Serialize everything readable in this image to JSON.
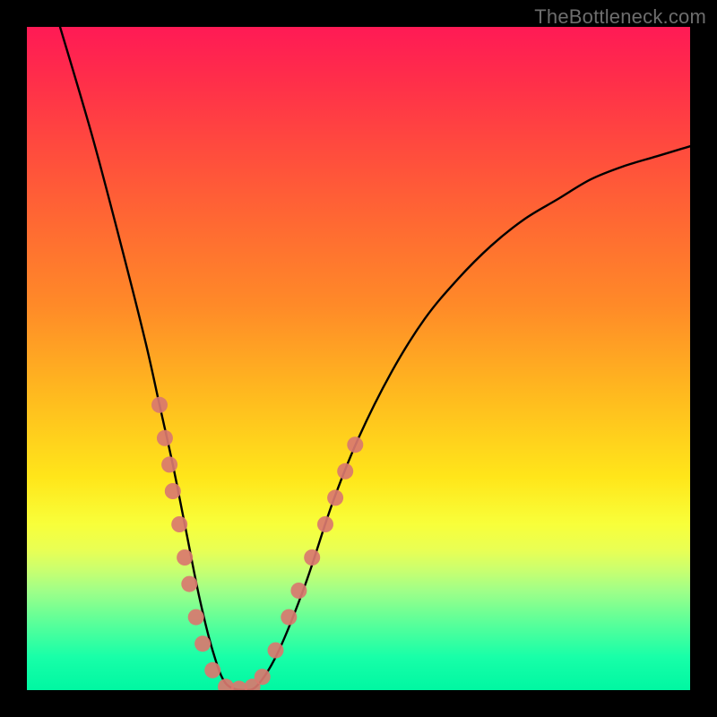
{
  "attribution": "TheBottleneck.com",
  "colors": {
    "black": "#000000",
    "curve_stroke": "#000000",
    "marker_fill": "#d9786f",
    "marker_stroke": "#d9786f",
    "attribution_text": "#6d6d6d"
  },
  "chart_data": {
    "type": "line",
    "title": "",
    "xlabel": "",
    "ylabel": "",
    "xlim": [
      0,
      100
    ],
    "ylim": [
      0,
      100
    ],
    "grid": false,
    "legend": false,
    "annotations": [],
    "series": [
      {
        "name": "curve",
        "x": [
          5,
          10,
          15,
          18,
          20,
          22,
          24,
          26,
          28,
          30,
          33,
          35,
          38,
          42,
          46,
          50,
          55,
          60,
          65,
          70,
          75,
          80,
          85,
          90,
          95,
          100
        ],
        "values": [
          100,
          83,
          64,
          52,
          43,
          34,
          24,
          14,
          6,
          1,
          0,
          1,
          6,
          16,
          28,
          38,
          48,
          56,
          62,
          67,
          71,
          74,
          77,
          79,
          80.5,
          82
        ]
      }
    ],
    "markers": [
      {
        "x": 20.0,
        "y": 43
      },
      {
        "x": 20.8,
        "y": 38
      },
      {
        "x": 21.5,
        "y": 34
      },
      {
        "x": 22.0,
        "y": 30
      },
      {
        "x": 23.0,
        "y": 25
      },
      {
        "x": 23.8,
        "y": 20
      },
      {
        "x": 24.5,
        "y": 16
      },
      {
        "x": 25.5,
        "y": 11
      },
      {
        "x": 26.5,
        "y": 7
      },
      {
        "x": 28.0,
        "y": 3
      },
      {
        "x": 30.0,
        "y": 0.5
      },
      {
        "x": 32.0,
        "y": 0.2
      },
      {
        "x": 34.0,
        "y": 0.5
      },
      {
        "x": 35.5,
        "y": 2
      },
      {
        "x": 37.5,
        "y": 6
      },
      {
        "x": 39.5,
        "y": 11
      },
      {
        "x": 41.0,
        "y": 15
      },
      {
        "x": 43.0,
        "y": 20
      },
      {
        "x": 45.0,
        "y": 25
      },
      {
        "x": 46.5,
        "y": 29
      },
      {
        "x": 48.0,
        "y": 33
      },
      {
        "x": 49.5,
        "y": 37
      }
    ]
  }
}
